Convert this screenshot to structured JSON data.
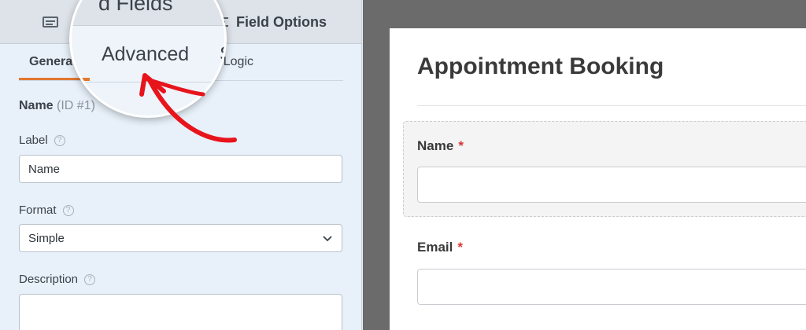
{
  "builder": {
    "top_tabs": {
      "fields_label": "Add Fields",
      "field_options_label": "Field Options"
    },
    "sub_tabs": [
      "General",
      "Advanced",
      "Smart Logic"
    ],
    "field": {
      "name": "Name",
      "id_text": "(ID #1)"
    },
    "options": {
      "label_label": "Label",
      "label_value": "Name",
      "format_label": "Format",
      "format_value": "Simple",
      "description_label": "Description",
      "help_glyph": "?"
    }
  },
  "magnifier": {
    "top_text": "d Fields",
    "advanced_label": "Advanced",
    "next_tab_fragment": "S"
  },
  "annotation": {
    "arrow_color": "#e8141c",
    "icon": "hand-drawn-arrow"
  },
  "preview": {
    "form_title": "Appointment Booking",
    "fields": [
      {
        "label": "Name",
        "required_mark": "*"
      },
      {
        "label": "Email",
        "required_mark": "*"
      }
    ]
  },
  "colors": {
    "accent_orange": "#e27730",
    "required_red": "#d63638",
    "panel_bg": "#e8f1fa",
    "preview_bg": "#6b6b6b"
  }
}
